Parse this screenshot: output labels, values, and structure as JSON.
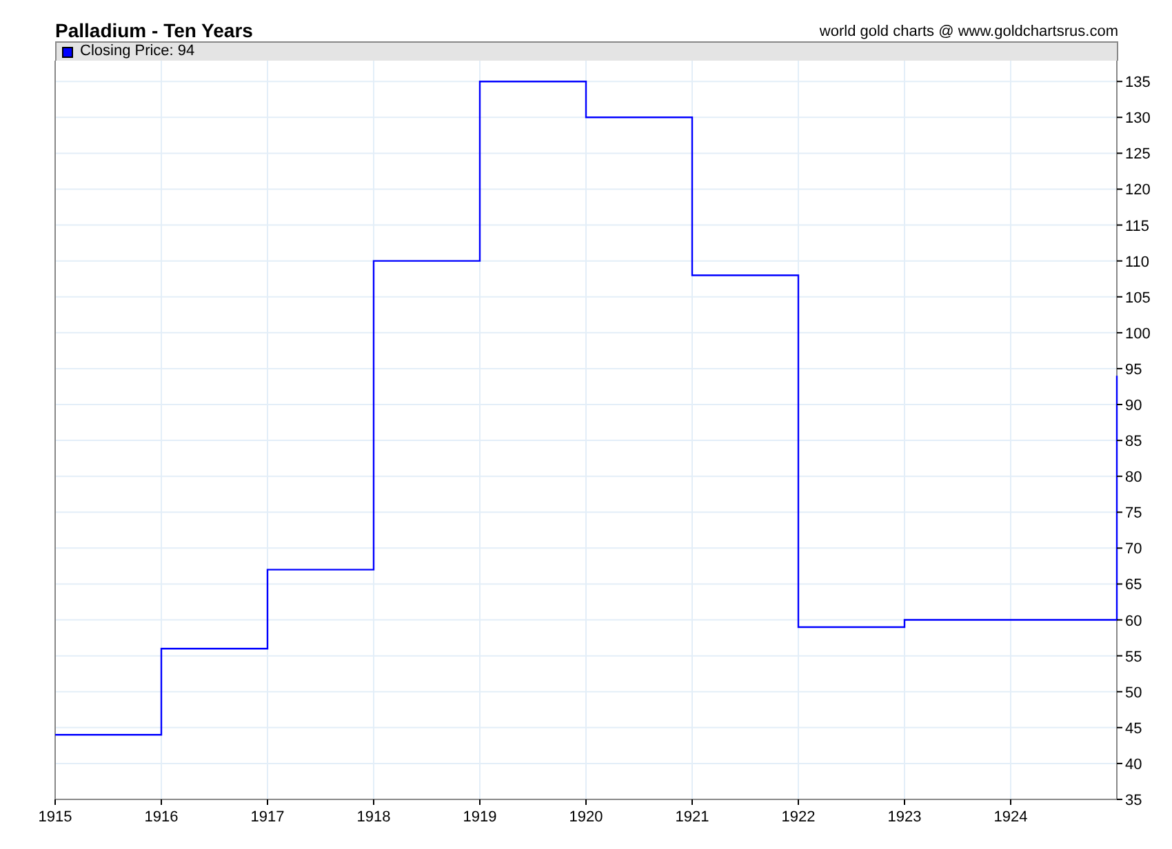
{
  "header": {
    "title": "Palladium - Ten Years",
    "credit": "world gold charts @ www.goldchartsrus.com"
  },
  "chart": {
    "legend": {
      "value_suffix": ": 94"
    },
    "chart_data": {
      "type": "line",
      "grid": true,
      "x": [
        1915,
        1916,
        1916,
        1917,
        1917,
        1918,
        1918,
        1919,
        1919,
        1920,
        1920,
        1921,
        1921,
        1922,
        1922,
        1923,
        1923,
        1924,
        1925,
        1925
      ],
      "series": [
        {
          "name": "Closing Price",
          "color": "#0000ff",
          "values": [
            44,
            44,
            56,
            56,
            67,
            67,
            110,
            110,
            135,
            135,
            130,
            130,
            108,
            108,
            59,
            59,
            60,
            60,
            60,
            94
          ]
        }
      ],
      "xlim": [
        1915,
        1925
      ],
      "ylim": [
        35,
        137.9
      ],
      "xticks": [
        1915,
        1916,
        1917,
        1918,
        1919,
        1920,
        1921,
        1922,
        1923,
        1924
      ],
      "yticks": [
        35,
        40,
        45,
        50,
        55,
        60,
        65,
        70,
        75,
        80,
        85,
        90,
        95,
        100,
        105,
        110,
        115,
        120,
        125,
        130,
        135
      ]
    }
  }
}
